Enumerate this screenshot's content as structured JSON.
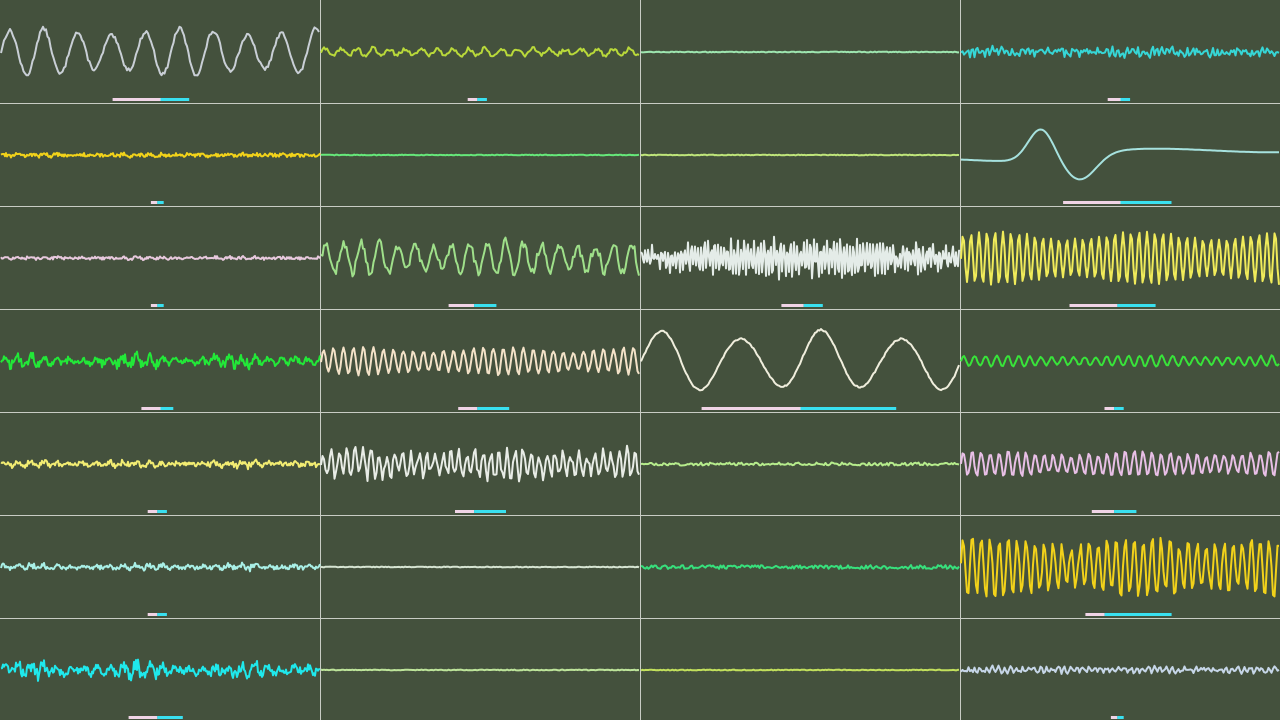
{
  "background_color": "#44513d",
  "grid_color": "#c8ccc4",
  "grid": {
    "columns": 4,
    "rows": 7
  },
  "channels": [
    {
      "row": 0,
      "col": 0,
      "color": "#c9cfd6",
      "amp": 0.62,
      "period": 34,
      "noise": 0.05,
      "shape": "sine",
      "meter": {
        "start": 0.35,
        "pink": 0.15,
        "cyan": 0.09
      }
    },
    {
      "row": 0,
      "col": 1,
      "color": "#b9d93a",
      "amp": 0.1,
      "period": 16,
      "noise": 0.05,
      "shape": "sine",
      "meter": {
        "start": 0.46,
        "pink": 0.03,
        "cyan": 0.03
      }
    },
    {
      "row": 0,
      "col": 2,
      "color": "#9ee6b0",
      "amp": 0.0,
      "period": 10,
      "noise": 0.01,
      "shape": "flat",
      "meter": null
    },
    {
      "row": 0,
      "col": 3,
      "color": "#36d6d6",
      "amp": 0.07,
      "period": 5,
      "noise": 0.1,
      "shape": "sine",
      "meter": {
        "start": 0.46,
        "pink": 0.04,
        "cyan": 0.03
      }
    },
    {
      "row": 1,
      "col": 0,
      "color": "#f2d21a",
      "amp": 0.05,
      "period": 3,
      "noise": 0.14,
      "shape": "noise",
      "meter": {
        "start": 0.47,
        "pink": 0.02,
        "cyan": 0.02
      }
    },
    {
      "row": 1,
      "col": 1,
      "color": "#66e87a",
      "amp": 0.0,
      "period": 10,
      "noise": 0.01,
      "shape": "flat",
      "meter": null
    },
    {
      "row": 1,
      "col": 2,
      "color": "#bfe57a",
      "amp": 0.0,
      "period": 10,
      "noise": 0.01,
      "shape": "flat",
      "meter": null
    },
    {
      "row": 1,
      "col": 3,
      "color": "#a6e2df",
      "amp": 0.72,
      "period": 300,
      "noise": 0.0,
      "shape": "pulse",
      "meter": {
        "start": 0.32,
        "pink": 0.18,
        "cyan": 0.16
      }
    },
    {
      "row": 2,
      "col": 0,
      "color": "#e7c8dd",
      "amp": 0.04,
      "period": 3,
      "noise": 0.1,
      "shape": "noise",
      "meter": {
        "start": 0.47,
        "pink": 0.02,
        "cyan": 0.02
      }
    },
    {
      "row": 2,
      "col": 1,
      "color": "#9fe08a",
      "amp": 0.42,
      "period": 18,
      "noise": 0.12,
      "shape": "sine",
      "meter": {
        "start": 0.4,
        "pink": 0.08,
        "cyan": 0.07
      }
    },
    {
      "row": 2,
      "col": 2,
      "color": "#e4ece8",
      "amp": 0.4,
      "period": 3,
      "noise": 0.18,
      "shape": "dense",
      "meter": {
        "start": 0.44,
        "pink": 0.07,
        "cyan": 0.06
      }
    },
    {
      "row": 2,
      "col": 3,
      "color": "#f0eb5a",
      "amp": 0.7,
      "period": 8,
      "noise": 0.02,
      "shape": "sine",
      "meter": {
        "start": 0.34,
        "pink": 0.15,
        "cyan": 0.12
      }
    },
    {
      "row": 3,
      "col": 0,
      "color": "#22e838",
      "amp": 0.25,
      "period": 3,
      "noise": 0.18,
      "shape": "noise",
      "meter": {
        "start": 0.44,
        "pink": 0.06,
        "cyan": 0.04
      }
    },
    {
      "row": 3,
      "col": 1,
      "color": "#f3e2c8",
      "amp": 0.35,
      "period": 10,
      "noise": 0.04,
      "shape": "sine",
      "meter": {
        "start": 0.43,
        "pink": 0.06,
        "cyan": 0.1
      }
    },
    {
      "row": 3,
      "col": 2,
      "color": "#f0eedd",
      "amp": 0.82,
      "period": 80,
      "noise": 0.02,
      "shape": "sine",
      "meter": {
        "start": 0.19,
        "pink": 0.31,
        "cyan": 0.3
      }
    },
    {
      "row": 3,
      "col": 3,
      "color": "#38e43a",
      "amp": 0.14,
      "period": 11,
      "noise": 0.02,
      "shape": "sine",
      "meter": {
        "start": 0.45,
        "pink": 0.03,
        "cyan": 0.03
      }
    },
    {
      "row": 4,
      "col": 0,
      "color": "#f2ec72",
      "amp": 0.1,
      "period": 3,
      "noise": 0.18,
      "shape": "noise",
      "meter": {
        "start": 0.46,
        "pink": 0.03,
        "cyan": 0.03
      }
    },
    {
      "row": 4,
      "col": 1,
      "color": "#e8ece6",
      "amp": 0.35,
      "period": 8,
      "noise": 0.15,
      "shape": "sine",
      "meter": {
        "start": 0.42,
        "pink": 0.06,
        "cyan": 0.1
      }
    },
    {
      "row": 4,
      "col": 2,
      "color": "#b6ec8c",
      "amp": 0.02,
      "period": 6,
      "noise": 0.04,
      "shape": "flat",
      "meter": null
    },
    {
      "row": 4,
      "col": 3,
      "color": "#e8bfe6",
      "amp": 0.32,
      "period": 9,
      "noise": 0.06,
      "shape": "sine",
      "meter": {
        "start": 0.41,
        "pink": 0.07,
        "cyan": 0.07
      }
    },
    {
      "row": 5,
      "col": 0,
      "color": "#a9efe6",
      "amp": 0.1,
      "period": 4,
      "noise": 0.15,
      "shape": "noise",
      "meter": {
        "start": 0.46,
        "pink": 0.03,
        "cyan": 0.03
      }
    },
    {
      "row": 5,
      "col": 1,
      "color": "#d6e4d2",
      "amp": 0.0,
      "period": 10,
      "noise": 0.01,
      "shape": "flat",
      "meter": null
    },
    {
      "row": 5,
      "col": 2,
      "color": "#37e07c",
      "amp": 0.0,
      "period": 10,
      "noise": 0.05,
      "shape": "flat",
      "meter": null
    },
    {
      "row": 5,
      "col": 3,
      "color": "#f2d21a",
      "amp": 0.75,
      "period": 9,
      "noise": 0.15,
      "shape": "sine",
      "meter": {
        "start": 0.39,
        "pink": 0.06,
        "cyan": 0.21
      }
    },
    {
      "row": 6,
      "col": 0,
      "color": "#1fe8ec",
      "amp": 0.28,
      "period": 3,
      "noise": 0.25,
      "shape": "noise",
      "meter": {
        "start": 0.4,
        "pink": 0.09,
        "cyan": 0.08
      }
    },
    {
      "row": 6,
      "col": 1,
      "color": "#bde49a",
      "amp": 0.0,
      "period": 10,
      "noise": 0.01,
      "shape": "flat",
      "meter": null
    },
    {
      "row": 6,
      "col": 2,
      "color": "#c2e05c",
      "amp": 0.0,
      "period": 10,
      "noise": 0.01,
      "shape": "flat",
      "meter": null
    },
    {
      "row": 6,
      "col": 3,
      "color": "#c6d6e8",
      "amp": 0.06,
      "period": 6,
      "noise": 0.06,
      "shape": "sine",
      "meter": {
        "start": 0.47,
        "pink": 0.02,
        "cyan": 0.02
      }
    }
  ]
}
